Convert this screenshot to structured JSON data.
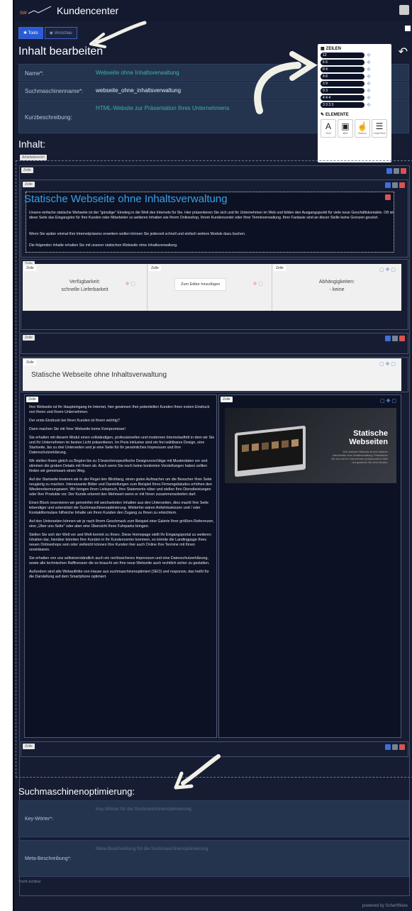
{
  "app": {
    "brand": "Kundencenter"
  },
  "toolbar": {
    "tools": "Tools",
    "preview": "Vorschau"
  },
  "sections": {
    "edit_title": "Inhalt bearbeiten",
    "content_title": "Inhalt:",
    "seo_title": "Suchmaschinenoptimierung:"
  },
  "fields": {
    "name_label": "Name*:",
    "name_value": "Webseite ohne Inhaltsverwaltung",
    "seo_name_label": "Suchmaschinenname*:",
    "seo_name_value": "webseite_ohne_inhaltsverwaltung",
    "short_label": "Kurzbeschreibung:",
    "short_value": "HTML-Website zur Präsentation Ihres Unternehmens"
  },
  "palette": {
    "rows_title": "ZEILEN",
    "rows": [
      "12",
      "6 6",
      "8 4",
      "4 8",
      "3 9",
      "9 3",
      "4 4 4",
      "3 3 3 3"
    ],
    "elements_title": "ELEMENTE",
    "elements": [
      "Text",
      "Bild",
      "Button",
      "Liste/Text"
    ]
  },
  "workspace": {
    "area_label": "Arbeitsbereich",
    "row_label": "Zeile"
  },
  "intro": {
    "title": "Statische Webseite ohne Inhaltsverwaltung",
    "p1": "Unsere einfache statische Webseite ist der \"günstige\" Einstieg in die Welt des Internets für Sie. Hier präsentieren Sie sich und Ihr Unternehmen im Web und bilden den Ausgangspunkt für viele neue Geschäftskontakte. Oft ist diese Seite das Eingangstor für Ihre Kunden oder Mitarbeiter zu weiteren Inhalten wie Ihrem Onlineshop, Ihrem Kundencenter oder Ihrer Terminverwaltung. Ihrer Fantasie sind an dieser Stelle keine Grenzen gesetzt.",
    "p2": "Wenn Sie später einmal Ihre Internetpräsenz erweitern wollen können Sie jederzeit schnell und einfach weitere Module dazu buchen.",
    "p3": "Die folgenden Inhalte erhalten Sie mit unserer statischen Webseite ohne Inhaltsverwaltung."
  },
  "cards": {
    "availability": "Verfügbarkeit:",
    "availability_val": "schnelle Lieferbarkeit",
    "add_editor": "Zum Editor hinzufügen",
    "deps": "Abhängigkeiten:",
    "deps_val": "- keine"
  },
  "banner": {
    "title": "Statische Webseite ohne Inhaltsverwaltung"
  },
  "body": [
    "Ihre Webseite ist Ihr Haupteingang im Internet, hier gewinnen Ihre potentiellen Kunden Ihren ersten Eindruck von Ihnen und Ihrem Unternehmen.",
    "Der erste Eindruck bei Ihren Kunden ist Ihnen wichtig?",
    "Dann machen Sie mit Ihrer Webseite keine Kompromisse!",
    "Sie erhalten mit diesem Modul einen vollständigen, professionellen und modernen Internetauftritt in dem wir Sie und Ihr Unternehmen im besten Licht präsentieren. Im Preis inklusive sind ein frei wählbares Design, eine Startseite, bis zu drei Unterseiten und je eine Seite für Ihr persönliches Impressum und Ihre Datenschutzerklärung.",
    "Wir stellen Ihnen gleich zu Beginn bis zu 3 branchenspezifische Designvorschläge mit Musterdaten vor und stimmen die groben Details mit Ihnen ab. Auch wenn Sie noch keine konkreten Vorstellungen haben sollten finden wir gemeinsam einen Weg.",
    "Auf der Startseite kreieren wir in der Regel den Blickfang, einen guten Aufmacher um die Besucher Ihrer Seite neugierig zu machen. Interessante Bilder und Darstellungen zum Beispiel Ihres Firmengebäudes erhöhen den Wiedererkennungswert. Wir bringen Ihren Leitspruch, Ihre Statements rüber und stellen Ihre Dienstleistungen oder Ihre Produkte vor. Der Kunde erkennt den Mehrwert wenn er mit Ihnen zusammenarbeiten darf.",
    "Einen Block reservieren wir gemeinhin mit wechselnden Inhalten aus den Unterseiten, dies macht Ihre Seite lebendiger und unterstützt die Suchmaschinenoptimierung. Weiterhin wären Anfahrtsskizzen und / oder Kontaktformulare hilfreiche Inhalte um Ihren Kunden den Zugang zu Ihnen zu erleichtern.",
    "Auf den Unterseiten können wir je nach Ihrem Geschmack zum Beispiel eine Galerie Ihrer größten Referenzen, eine „Über uns-Seite\" oder aber eine Übersicht Ihres Fuhrparks bringen.",
    "Stellen Sie sich der Welt vor und Welt kommt zu Ihnen. Diese Homepage stellt Ihr Eingangsportal zu weiteren Inhalten dar, hierüber könnten Ihre Kunden in Ihr Kundencenter kommen, es könnte die Landingpage Ihres neuen Onlineshops sein oder vielleicht können Ihre Kunden hier auch Online Ihre Termine mit Ihnen vereinbaren.",
    "Sie erhalten von uns selbstverständlich auch ein rechtssicheres Impressum und eine Datenschutzerklärung, sowie alle technischen Raffinessen die es braucht um Ihre neue Webseite auch rechtlich sicher zu gestalten.",
    "Außerdem sind alle Webauftritte von Hause aus suchmaschinenoptimiert (SEO) und responsiv, das heißt für die Darstellung auf dem Smartphone optimiert."
  ],
  "mockup": {
    "title1": "Statische",
    "title2": "Webseiten",
    "desc": "Eine statische Webseite ist eine einfache Internetseite ohne Inhaltsverwaltung. Präsentieren Sie sich und Ihr Unternehmen professionell im Web und gewinnen Sie neue Kunden."
  },
  "seo": {
    "keywords_label": "Key-Wörter*:",
    "keywords_ph": "Key-Wörter für die Suchmaschinenoptimierung",
    "meta_label": "Meta-Beschreibung*:",
    "meta_ph": "Meta-Beschreibung für die Suchmaschinenoptimierung",
    "hint": "*nicht sichtbar"
  },
  "footer": {
    "text": "powered by ScherfWare"
  }
}
